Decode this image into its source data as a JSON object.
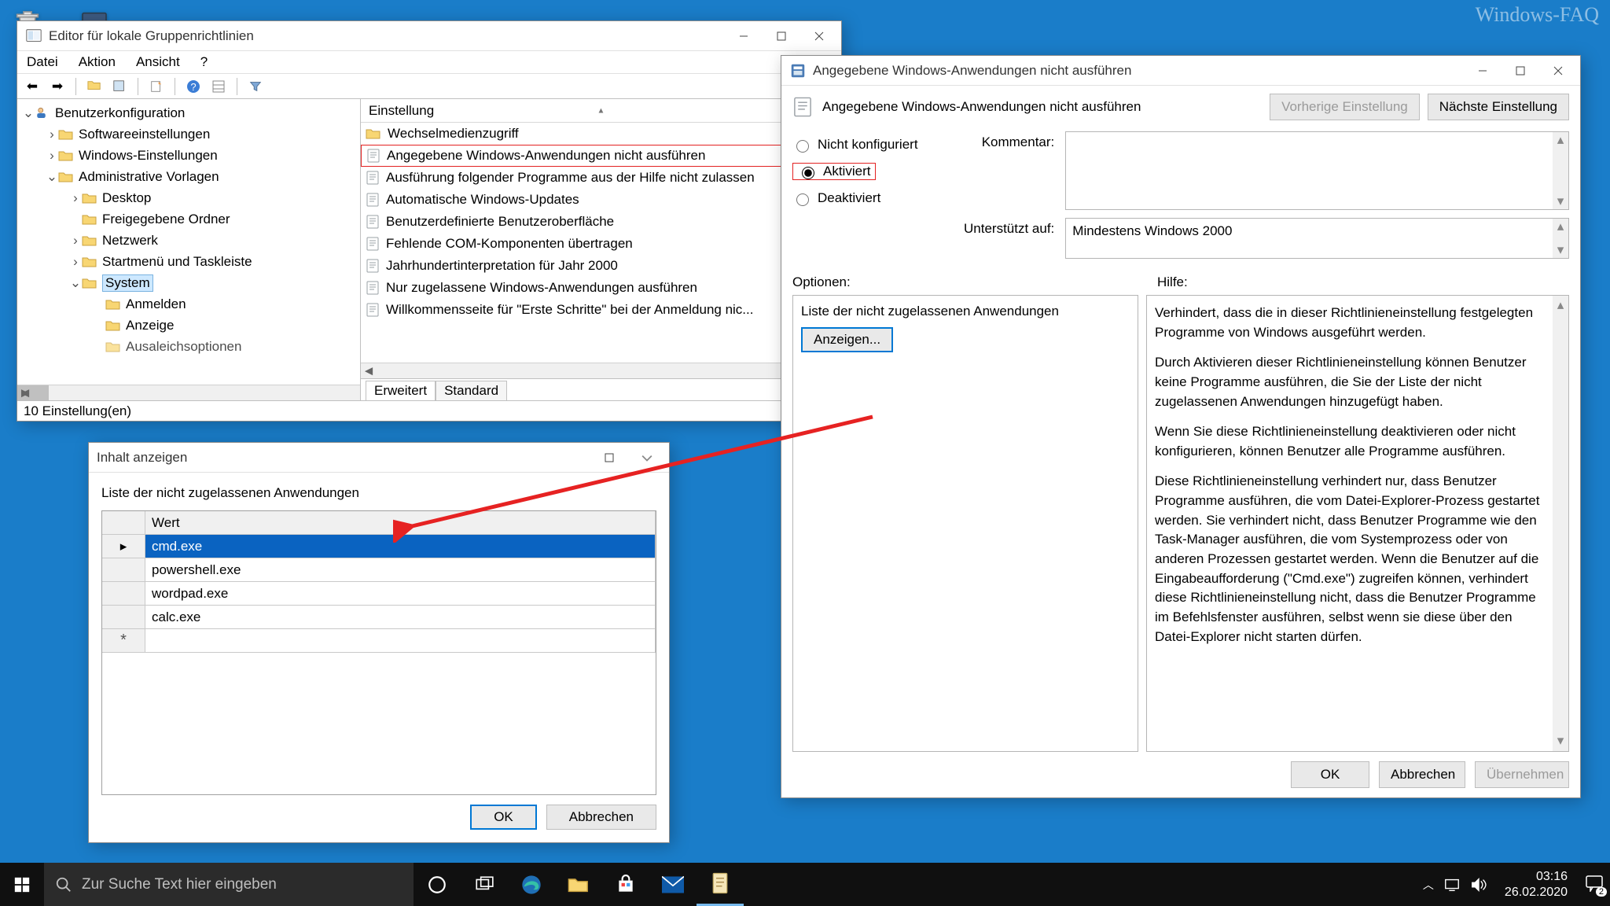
{
  "watermark": "Windows-FAQ",
  "gpe": {
    "title": "Editor für lokale Gruppenrichtlinien",
    "menu": {
      "file": "Datei",
      "action": "Aktion",
      "view": "Ansicht",
      "help": "?"
    },
    "tree": {
      "root": "Benutzerkonfiguration",
      "n1": "Softwareeinstellungen",
      "n2": "Windows-Einstellungen",
      "n3": "Administrative Vorlagen",
      "c1": "Desktop",
      "c2": "Freigegebene Ordner",
      "c3": "Netzwerk",
      "c4": "Startmenü und Taskleiste",
      "c5": "System",
      "g1": "Anmelden",
      "g2": "Anzeige",
      "g3": "Ausaleichsoptionen"
    },
    "list_header": "Einstellung",
    "items": {
      "i0": "Wechselmedienzugriff",
      "i1": "Angegebene Windows-Anwendungen nicht ausführen",
      "i2": "Ausführung folgender Programme aus der Hilfe nicht zulassen",
      "i3": "Automatische Windows-Updates",
      "i4": "Benutzerdefinierte Benutzeroberfläche",
      "i5": "Fehlende COM-Komponenten übertragen",
      "i6": "Jahrhundertinterpretation für Jahr 2000",
      "i7": "Nur zugelassene Windows-Anwendungen ausführen",
      "i8": "Willkommensseite für \"Erste Schritte\" bei der Anmeldung nic..."
    },
    "tabs": {
      "ext": "Erweitert",
      "std": "Standard"
    },
    "status": "10 Einstellung(en)"
  },
  "policy": {
    "title": "Angegebene Windows-Anwendungen nicht ausführen",
    "heading": "Angegebene Windows-Anwendungen nicht ausführen",
    "prev": "Vorherige Einstellung",
    "next": "Nächste Einstellung",
    "radio1": "Nicht konfiguriert",
    "radio2": "Aktiviert",
    "radio3": "Deaktiviert",
    "comment_label": "Kommentar:",
    "supported_label": "Unterstützt auf:",
    "supported_value": "Mindestens Windows 2000",
    "options_label": "Optionen:",
    "help_label": "Hilfe:",
    "option_list_label": "Liste der nicht zugelassenen Anwendungen",
    "show_button": "Anzeigen...",
    "help_p1": "Verhindert, dass die in dieser Richtlinieneinstellung festgelegten Programme von Windows ausgeführt werden.",
    "help_p2": "Durch Aktivieren dieser Richtlinieneinstellung können Benutzer keine Programme ausführen, die Sie der Liste der nicht zugelassenen Anwendungen hinzugefügt haben.",
    "help_p3": "Wenn Sie diese Richtlinieneinstellung deaktivieren oder nicht konfigurieren, können Benutzer alle Programme ausführen.",
    "help_p4": "Diese Richtlinieneinstellung verhindert nur, dass Benutzer Programme ausführen, die vom Datei-Explorer-Prozess gestartet werden. Sie verhindert nicht, dass Benutzer Programme wie den Task-Manager ausführen, die vom Systemprozess oder von anderen Prozessen gestartet werden.  Wenn die Benutzer auf die Eingabeaufforderung (\"Cmd.exe\") zugreifen können, verhindert diese Richtlinieneinstellung nicht, dass die Benutzer Programme im Befehlsfenster ausführen, selbst wenn sie diese über den Datei-Explorer nicht starten dürfen.",
    "ok": "OK",
    "cancel": "Abbrechen",
    "apply": "Übernehmen"
  },
  "content": {
    "title": "Inhalt anzeigen",
    "label": "Liste der nicht zugelassenen Anwendungen",
    "col": "Wert",
    "rows": {
      "r0": "cmd.exe",
      "r1": "powershell.exe",
      "r2": "wordpad.exe",
      "r3": "calc.exe"
    },
    "ok": "OK",
    "cancel": "Abbrechen"
  },
  "taskbar": {
    "search_placeholder": "Zur Suche Text hier eingeben",
    "time": "03:16",
    "date": "26.02.2020",
    "notif_count": "2"
  }
}
